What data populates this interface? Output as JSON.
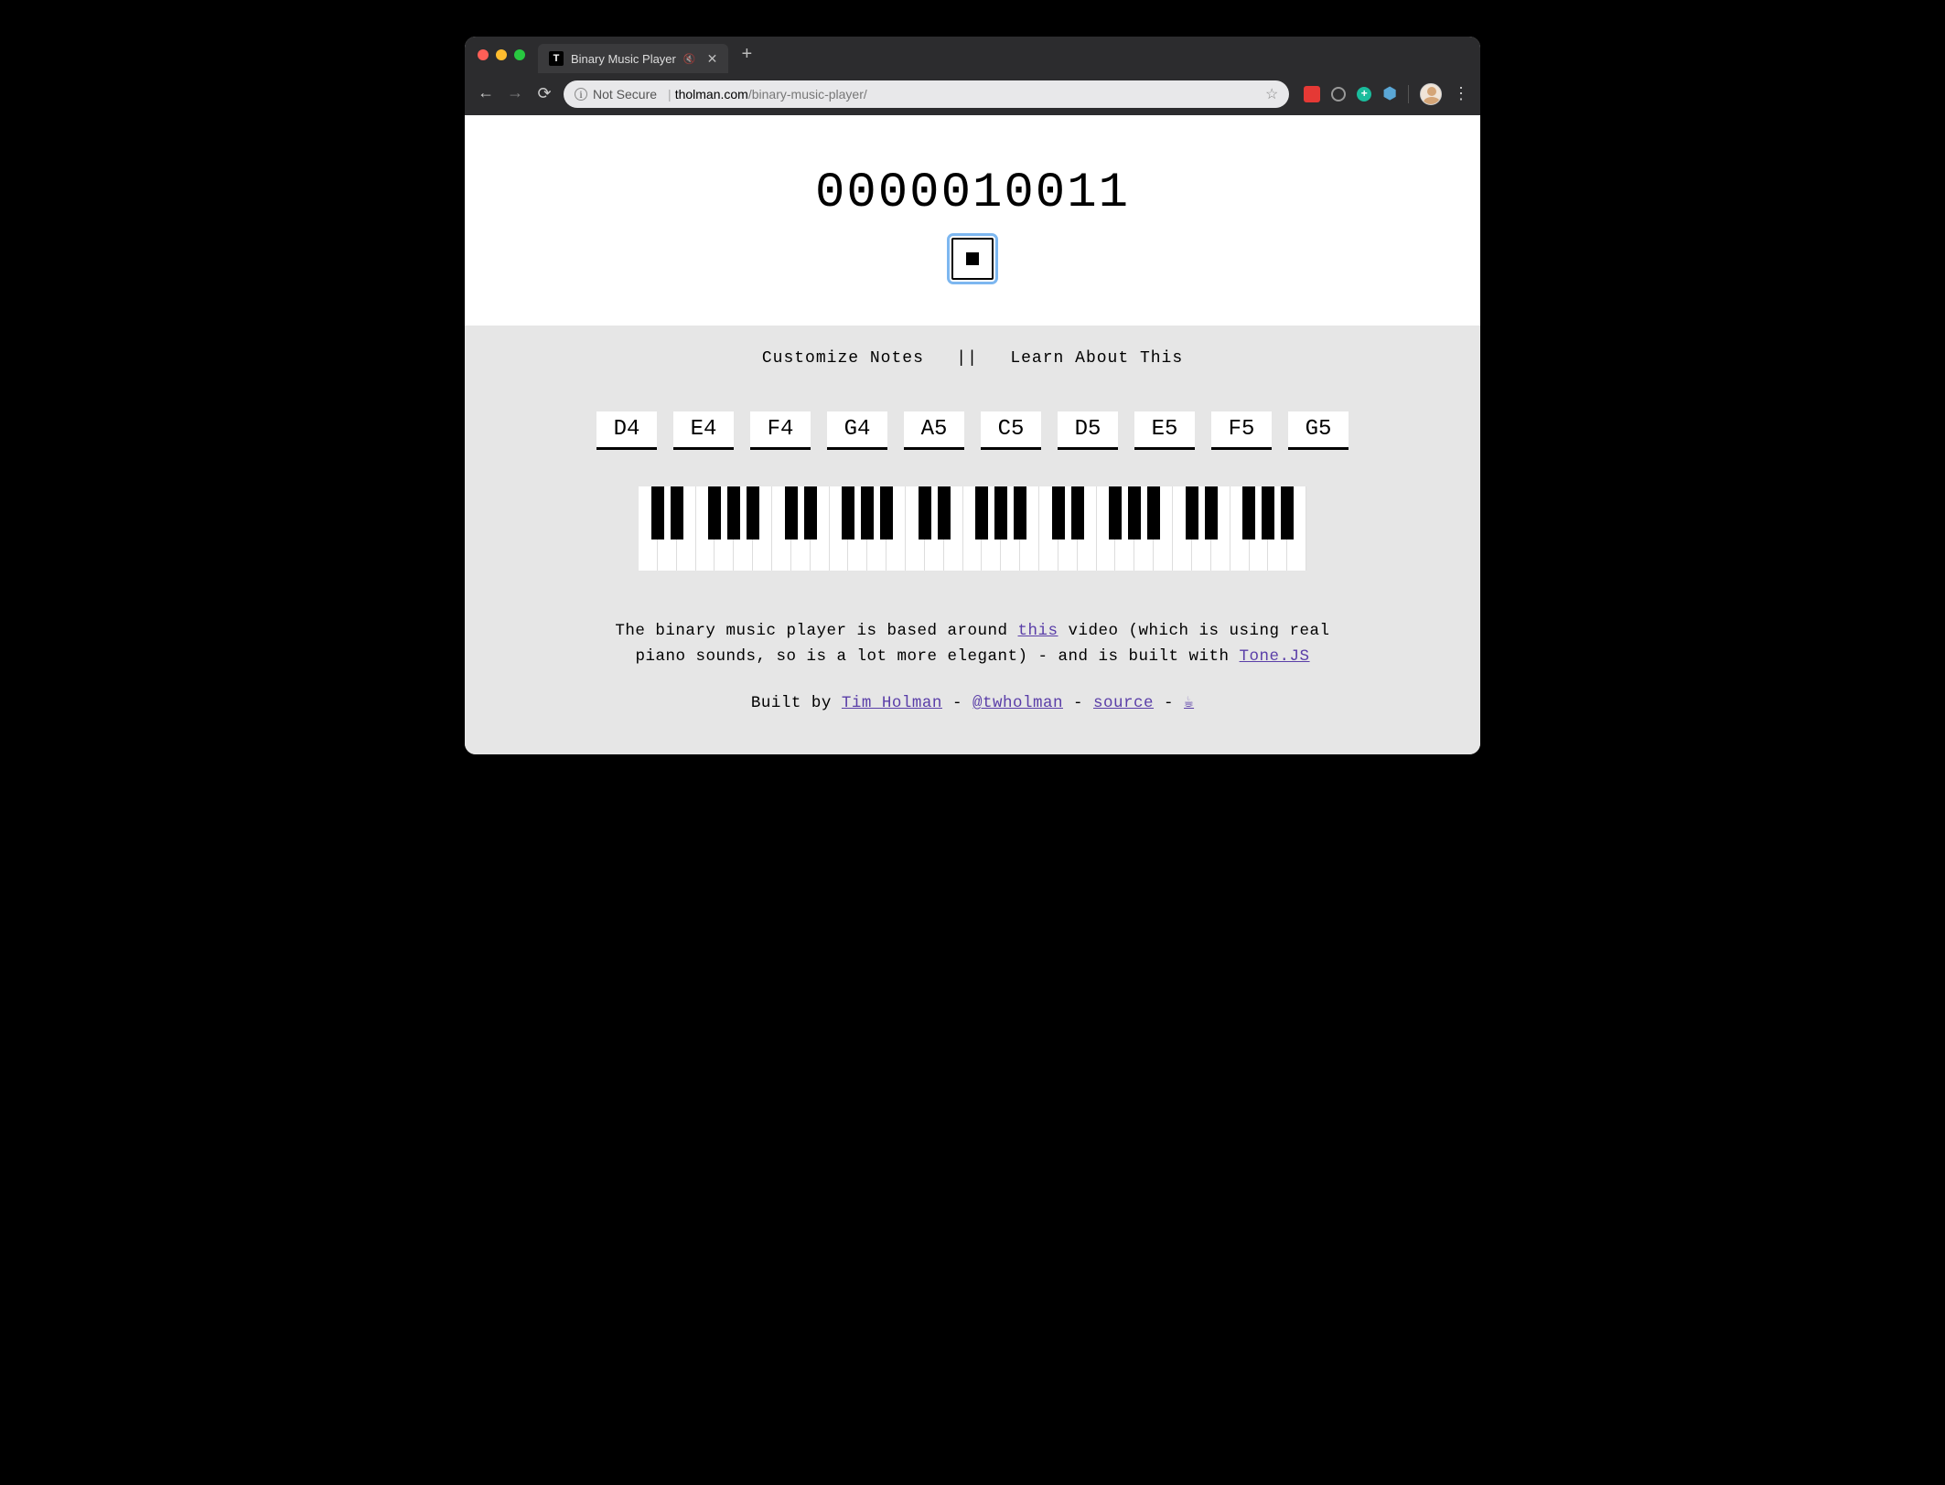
{
  "browser": {
    "tab_title": "Binary Music Player",
    "not_secure_label": "Not Secure",
    "url_domain": "tholman.com",
    "url_path": "/binary-music-player/"
  },
  "page": {
    "binary_display": "0000010011",
    "links": {
      "customize": "Customize Notes",
      "separator": "||",
      "learn": "Learn About This"
    },
    "notes": [
      "D4",
      "E4",
      "F4",
      "G4",
      "A5",
      "C5",
      "D5",
      "E5",
      "F5",
      "G5"
    ],
    "desc": {
      "pre": "The binary music player is based around ",
      "link1": "this",
      "mid": " video (which is using real piano sounds, so is a lot more elegant) - and is built with ",
      "link2": "Tone.JS"
    },
    "credits": {
      "built_by": "Built by ",
      "author": "Tim Holman",
      "dash": " - ",
      "handle": "@twholman",
      "source": "source",
      "coffee": "☕"
    }
  }
}
